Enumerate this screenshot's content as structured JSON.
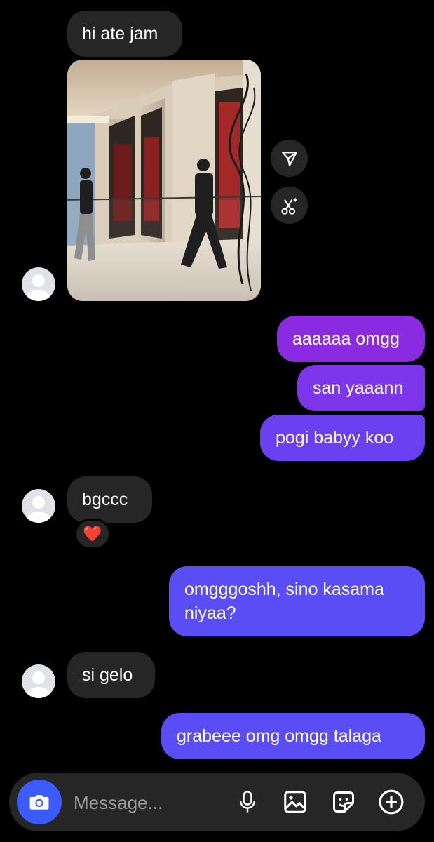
{
  "messages": {
    "m1": "hi ate jam",
    "m2": "aaaaaa omgg",
    "m3": "san yaaann",
    "m4": "pogi babyy koo",
    "m5": "bgccc",
    "m5_reaction": "❤️",
    "m6_line1": "omgggoshh, sino kasama",
    "m6_line2": "niyaa?",
    "m7": "si gelo",
    "m8": "grabeee omg omgg talaga"
  },
  "composer": {
    "placeholder": "Message..."
  },
  "colors": {
    "incoming_bubble": "#262626",
    "outgoing_top": "#8a2be2",
    "outgoing_bottom": "#5b4df5",
    "camera_button": "#3b5bfd",
    "background": "#000000"
  },
  "icons": [
    "send-icon",
    "scissors-sparkle-icon",
    "camera-icon",
    "microphone-icon",
    "gallery-icon",
    "sticker-icon",
    "plus-circle-icon"
  ]
}
